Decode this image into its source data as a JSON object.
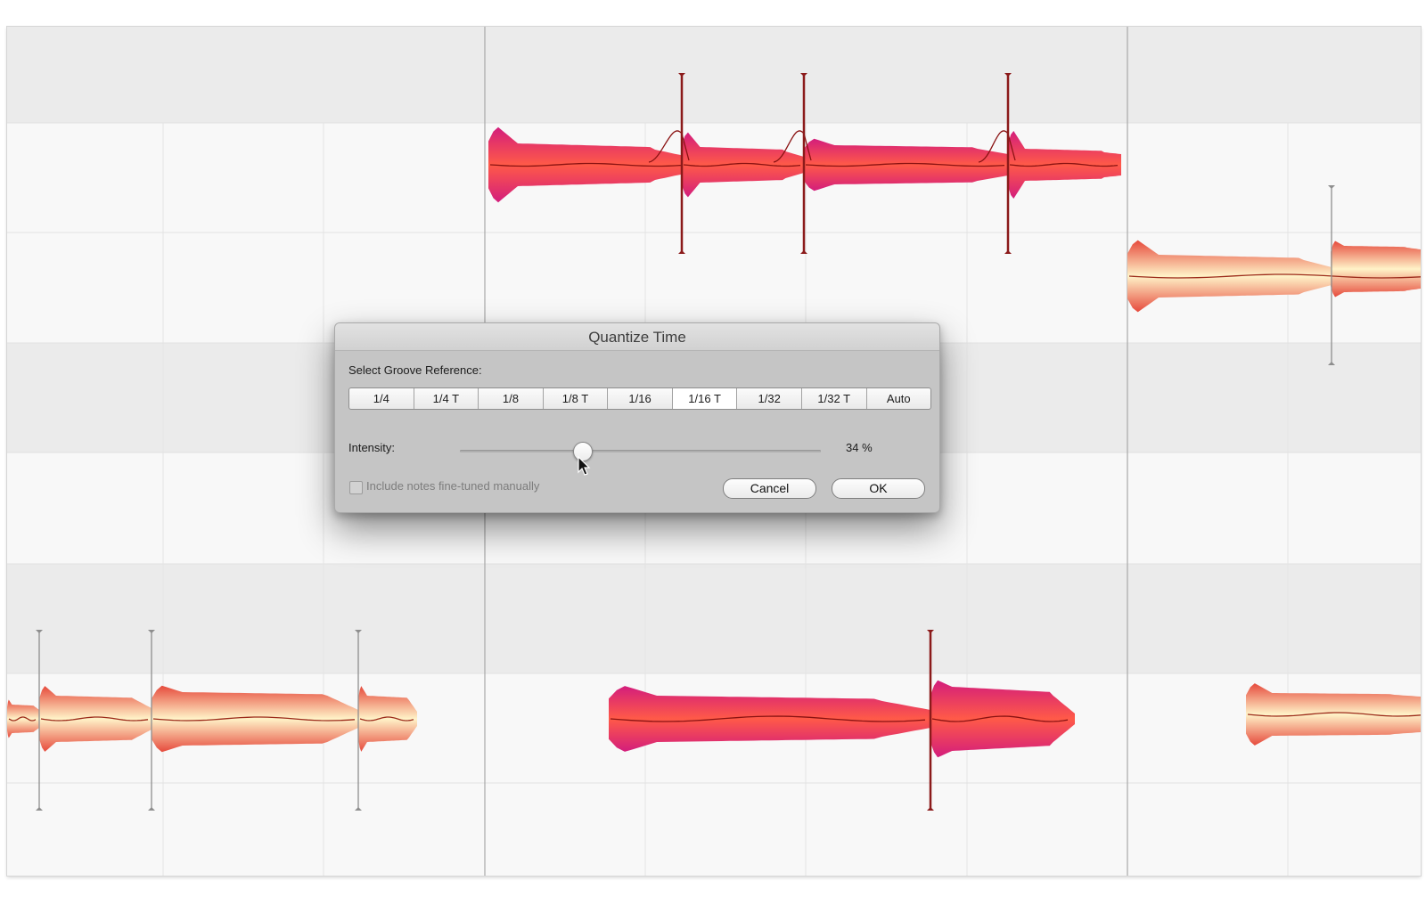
{
  "dialog": {
    "title": "Quantize Time",
    "groove_label": "Select Groove Reference:",
    "groove_options": [
      "1/4",
      "1/4 T",
      "1/8",
      "1/8 T",
      "1/16",
      "1/16 T",
      "1/32",
      "1/32 T",
      "Auto"
    ],
    "selected_groove": "1/16 T",
    "intensity_label": "Intensity:",
    "intensity_value": 34,
    "intensity_text": "34 %",
    "include_label": "Include notes fine-tuned manually",
    "include_checked": false,
    "include_enabled": false,
    "cancel_label": "Cancel",
    "ok_label": "OK"
  },
  "colors": {
    "selected_note_outer": "#d31d7c",
    "selected_note_inner": "#ff5a48",
    "note_outer": "#e64a3c",
    "note_inner": "#fff3c8",
    "separator_selected": "#8b1a1a",
    "separator": "#8e8e8e",
    "band_dark": "#ebebeb",
    "band_light": "#f8f8f8",
    "grid_line": "#e4e4e4",
    "bar_line": "#a8a8a8"
  }
}
